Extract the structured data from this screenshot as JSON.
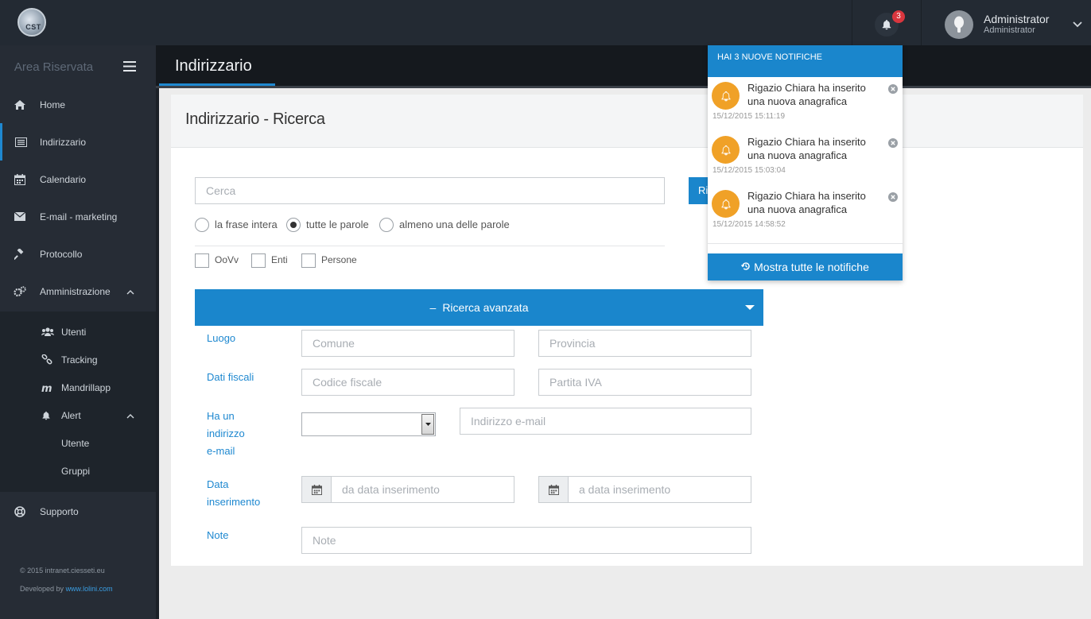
{
  "logo": {
    "text": "CST"
  },
  "header": {
    "notifications_count": "3",
    "user_name": "Administrator",
    "user_role": "Administrator"
  },
  "sidebar": {
    "brand": "Area Riservata",
    "items": [
      {
        "label": "Home",
        "icon": "home-icon"
      },
      {
        "label": "Indirizzario",
        "icon": "list-icon"
      },
      {
        "label": "Calendario",
        "icon": "calendar-icon"
      },
      {
        "label": "E-mail - marketing",
        "icon": "envelope-icon"
      },
      {
        "label": "Protocollo",
        "icon": "gavel-icon"
      },
      {
        "label": "Amministrazione",
        "icon": "cogs-icon"
      }
    ],
    "admin_sub": [
      {
        "label": "Utenti",
        "icon": "users-icon"
      },
      {
        "label": "Tracking",
        "icon": "link-icon"
      },
      {
        "label": "Mandrillapp",
        "icon": "mandrill-icon"
      },
      {
        "label": "Alert",
        "icon": "bell-icon"
      }
    ],
    "alert_sub": [
      {
        "label": "Utente"
      },
      {
        "label": "Gruppi"
      }
    ],
    "support": "Supporto",
    "footer_copyright": "© 2015 intranet.ciesseti.eu",
    "footer_developed": "Developed by",
    "footer_link": "www.lolini.com"
  },
  "page": {
    "title": "Indirizzario",
    "panel_title": "Indirizzario - Ricerca"
  },
  "search": {
    "placeholder": "Cerca",
    "button_label": "Ricerca",
    "radios": [
      {
        "label": "la frase intera",
        "checked": false
      },
      {
        "label": "tutte le parole",
        "checked": true
      },
      {
        "label": "almeno una delle parole",
        "checked": false
      }
    ],
    "checkboxes": [
      {
        "label": "OoVv"
      },
      {
        "label": "Enti"
      },
      {
        "label": "Persone"
      }
    ]
  },
  "advanced": {
    "toggle_label": "Ricerca avanzata",
    "luogo_label": "Luogo",
    "comune_placeholder": "Comune",
    "provincia_placeholder": "Provincia",
    "fiscali_label": "Dati fiscali",
    "cf_placeholder": "Codice fiscale",
    "piva_placeholder": "Partita IVA",
    "email_label_1": "Ha un",
    "email_label_2": "indirizzo",
    "email_label_3": "e-mail",
    "email_placeholder": "Indirizzo e-mail",
    "data_label_1": "Data",
    "data_label_2": "inserimento",
    "from_placeholder": "da data inserimento",
    "to_placeholder": "a data inserimento",
    "note_label": "Note",
    "note_placeholder": "Note"
  },
  "notifications": {
    "header": "HAI 3 NUOVE NOTIFICHE",
    "items": [
      {
        "line1": "Rigazio Chiara ha inserito",
        "line2": "una nuova anagrafica",
        "time": "15/12/2015 15:11:19"
      },
      {
        "line1": "Rigazio Chiara ha inserito",
        "line2": "una nuova anagrafica",
        "time": "15/12/2015 15:03:04"
      },
      {
        "line1": "Rigazio Chiara ha inserito",
        "line2": "una nuova anagrafica",
        "time": "15/12/2015 14:58:52"
      }
    ],
    "show_all": "Mostra tutte le notifiche"
  },
  "colors": {
    "accent": "#1a86cc",
    "topbar": "#232a33",
    "sidebar": "#262c35",
    "notif_icon": "#f0a127",
    "badge": "#d9363e"
  }
}
